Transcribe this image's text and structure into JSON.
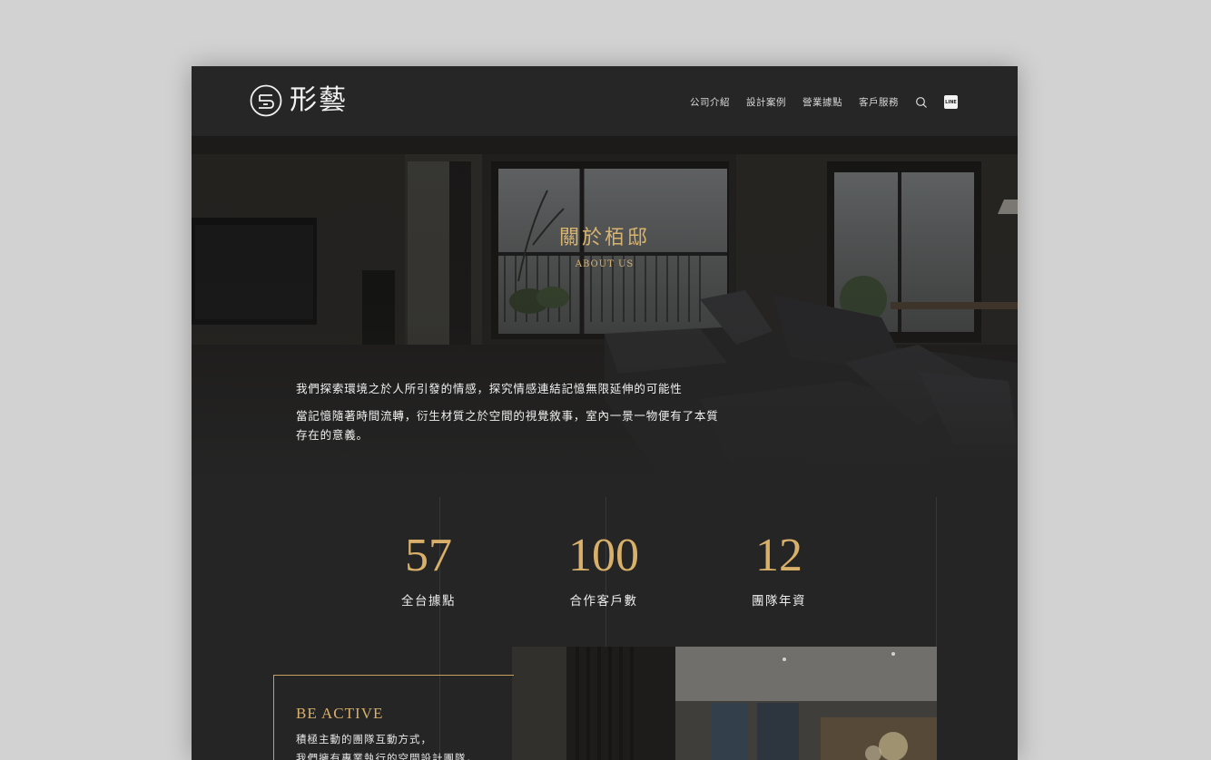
{
  "brand": {
    "name": "形藝",
    "gold": "#d8b06a",
    "bg": "#252525"
  },
  "nav": {
    "items": [
      "公司介紹",
      "設計案例",
      "營業據點",
      "客戶服務"
    ],
    "search_icon": "search-icon",
    "line_icon": "line-icon",
    "line_text": "LINE"
  },
  "hero": {
    "title": "關於栢邸",
    "subtitle": "ABOUT US",
    "paragraph1": "我們探索環境之於人所引發的情感，探究情感連結記憶無限延伸的可能性",
    "paragraph2": "當記憶隨著時間流轉，衍生材質之於空間的視覺敘事，室內一景一物便有了本質存在的意義。"
  },
  "stats": [
    {
      "value": "57",
      "label": "全台據點"
    },
    {
      "value": "100",
      "label": "合作客戶數"
    },
    {
      "value": "12",
      "label": "團隊年資"
    }
  ],
  "feature": {
    "title": "BE ACTIVE",
    "line1": "積極主動的團隊互動方式，",
    "line2": "我們擁有專業執行的空間設計團隊，"
  }
}
